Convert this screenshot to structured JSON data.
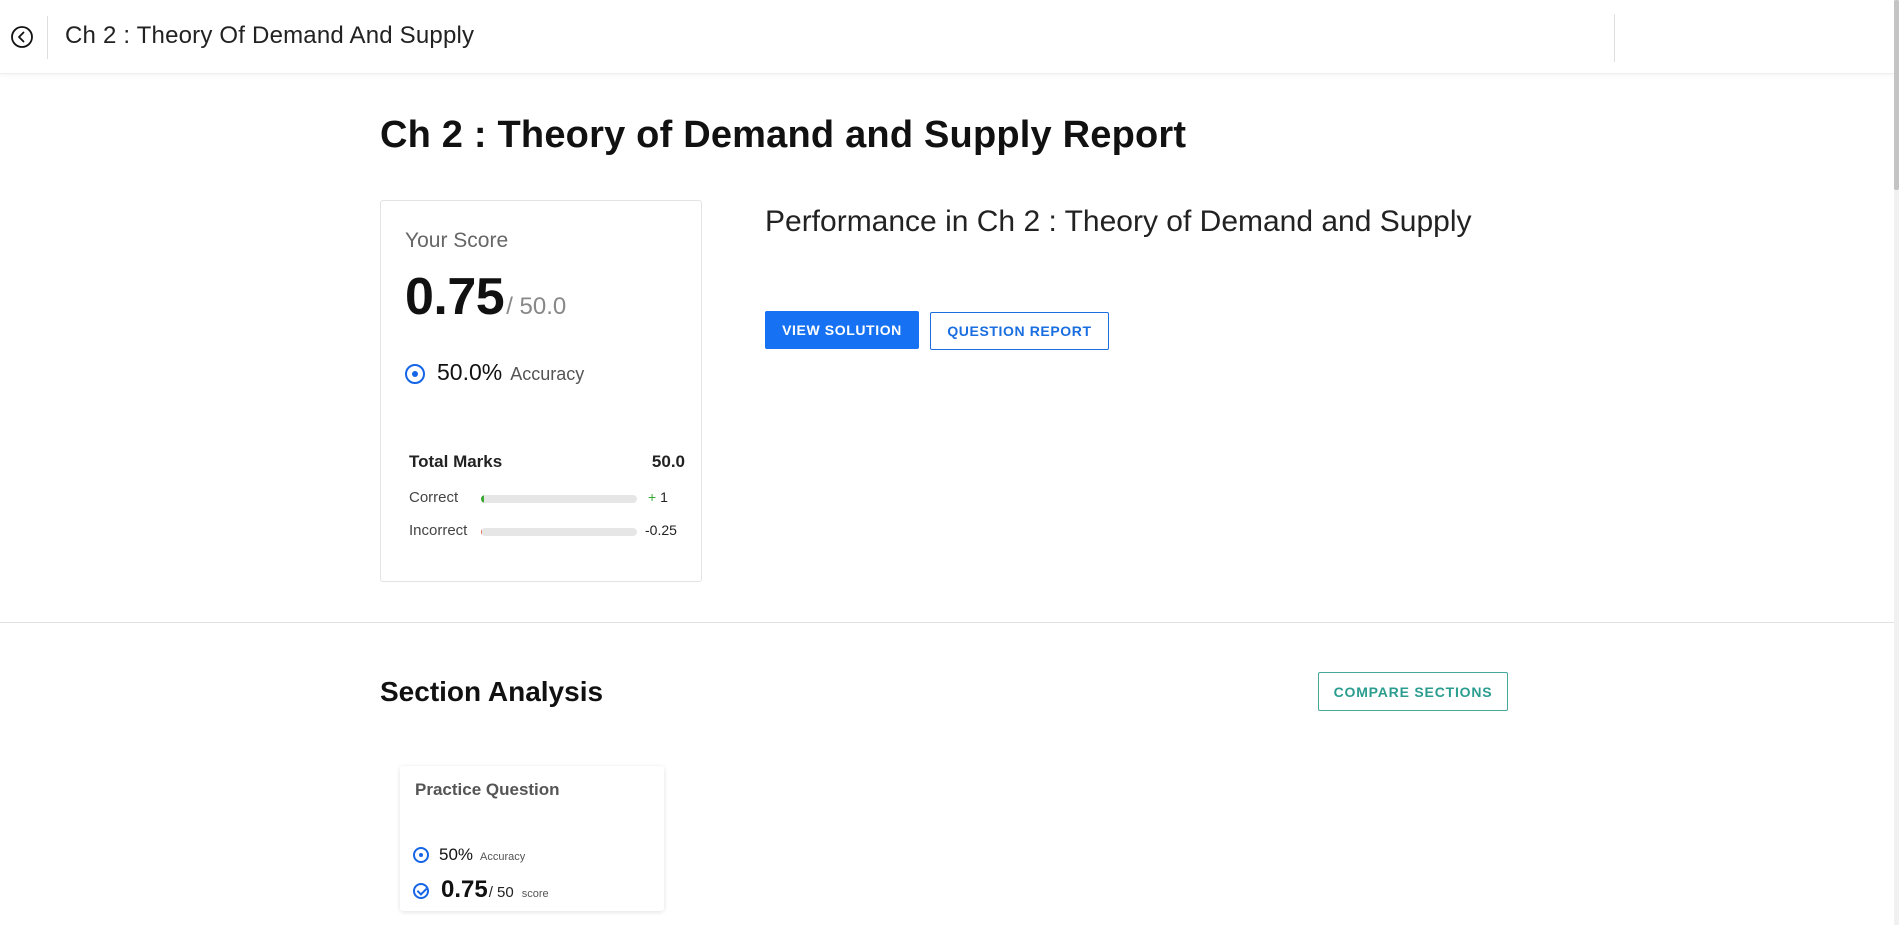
{
  "header": {
    "title": "Ch 2 : Theory Of Demand And Supply"
  },
  "page": {
    "title": "Ch 2 : Theory of Demand and Supply Report"
  },
  "score_card": {
    "label": "Your Score",
    "score": "0.75",
    "max": "/ 50.0",
    "accuracy_value": "50.0%",
    "accuracy_label": "Accuracy",
    "total_marks_label": "Total Marks",
    "total_marks_value": "50.0",
    "correct_label": "Correct",
    "correct_sign": "+",
    "correct_value": "1",
    "correct_fraction": 0.02,
    "correct_color": "#3aa832",
    "incorrect_label": "Incorrect",
    "incorrect_value": "-0.25",
    "incorrect_fraction": 0.005,
    "incorrect_color": "#e0705a"
  },
  "performance": {
    "title": "Performance in Ch 2 : Theory of Demand and Supply",
    "view_solution_label": "VIEW SOLUTION",
    "question_report_label": "QUESTION REPORT"
  },
  "section_analysis": {
    "title": "Section Analysis",
    "compare_label": "COMPARE SECTIONS",
    "sections": [
      {
        "name": "Practice Question",
        "accuracy_value": "50%",
        "accuracy_label": "Accuracy",
        "score": "0.75",
        "max": "/ 50",
        "score_label": "score"
      }
    ]
  },
  "colors": {
    "primary": "#1672f3",
    "teal": "#2a9d8f"
  },
  "icons": {
    "back": "circle-arrow-left-icon",
    "accuracy": "target-icon",
    "score": "check-circle-icon"
  }
}
